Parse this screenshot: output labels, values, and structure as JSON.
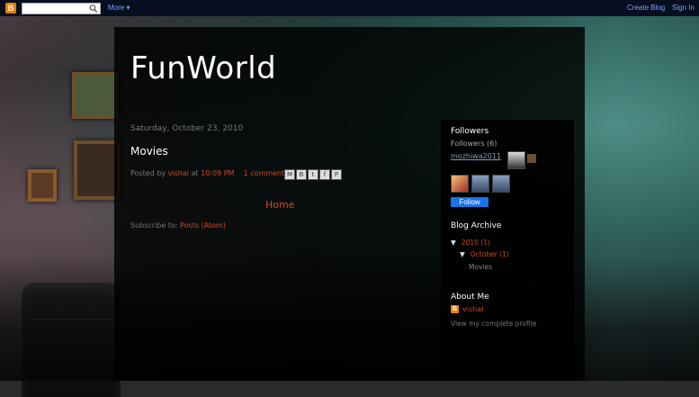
{
  "navbar": {
    "logo_letter": "B",
    "search_placeholder": "",
    "more_label": "More ▾",
    "create_blog_label": "Create Blog",
    "sign_in_label": "Sign In"
  },
  "blog": {
    "title": "FunWorld"
  },
  "post": {
    "date": "Saturday, October 23, 2010",
    "title": "Movies",
    "posted_by_label": "Posted by",
    "author": "vishal",
    "at_label": "at",
    "time": "10:09 PM",
    "comments": "1 comment:",
    "share_icons": [
      "M",
      "B",
      "t",
      "f",
      "P"
    ]
  },
  "navigation": {
    "home_label": "Home"
  },
  "subscribe": {
    "label": "Subscribe to:",
    "link": "Posts (Atom)"
  },
  "sidebar": {
    "followers": {
      "title": "Followers",
      "count": "Followers (6)",
      "first_follower": "mozhiwa2011",
      "follow_label": "Follow"
    },
    "archive": {
      "title": "Blog Archive",
      "year": "2010",
      "year_count": "(1)",
      "month": "October",
      "month_count": "(1)",
      "post": "Movies",
      "expanded_arrow": "▼"
    },
    "about": {
      "title": "About Me",
      "name": "vishal",
      "profile_link": "View my complete profile"
    }
  },
  "colors": {
    "navbar_bg": "#060e1f",
    "link": "#d0491f",
    "nav_link": "#6fa8ff",
    "follow_button": "#1a73e8",
    "blogger_orange": "#f57d00"
  }
}
